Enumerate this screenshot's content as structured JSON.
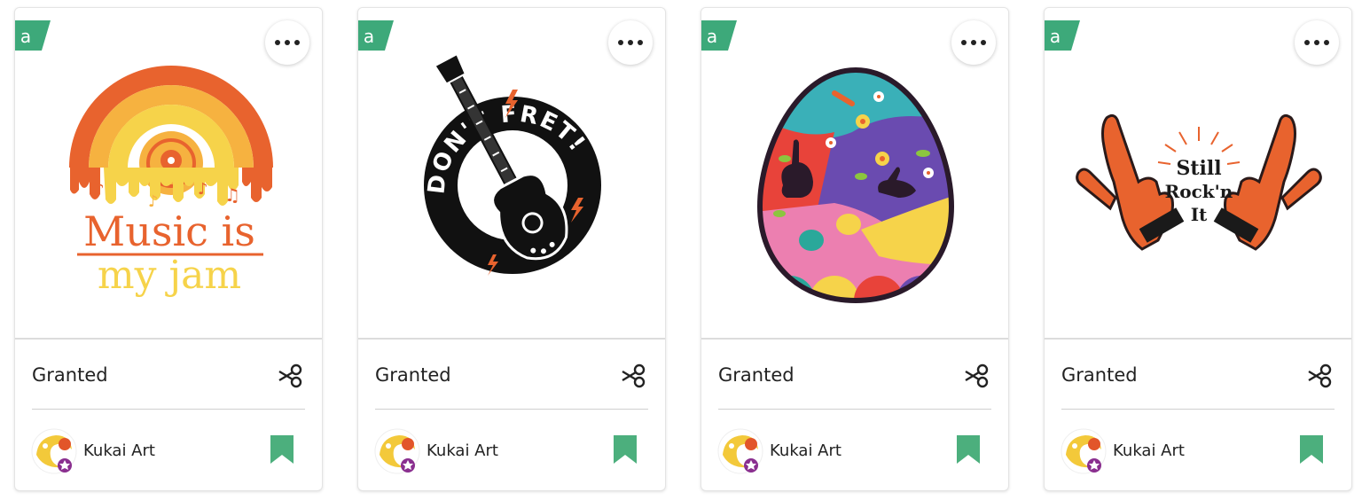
{
  "colors": {
    "badge_green": "#3da97a",
    "save_green": "#4caf7d",
    "avatar_yellow": "#f3c93a",
    "avatar_orange": "#e2552a",
    "avatar_purple": "#8a2f8f"
  },
  "cards": [
    {
      "art": "music-is-my-jam-rainbow-record",
      "art_text_line1": "Music is",
      "art_text_line2": "my jam",
      "license": "Granted",
      "designer": "Kukai Art",
      "badge_icon": "access-a-icon",
      "cut_icon": "scissors-icon",
      "save_icon": "bookmark-icon"
    },
    {
      "art": "dont-fret-guitar-circle",
      "art_text": "DON'T FRET!",
      "license": "Granted",
      "designer": "Kukai Art",
      "badge_icon": "access-a-icon",
      "cut_icon": "scissors-icon",
      "save_icon": "bookmark-icon"
    },
    {
      "art": "easter-egg-mosaic",
      "license": "Granted",
      "designer": "Kukai Art",
      "badge_icon": "access-a-icon",
      "cut_icon": "scissors-icon",
      "save_icon": "bookmark-icon"
    },
    {
      "art": "still-rockn-it-hands",
      "art_text_line1": "Still",
      "art_text_line2": "Rock'n",
      "art_text_line3": "It",
      "license": "Granted",
      "designer": "Kukai Art",
      "badge_icon": "access-a-icon",
      "cut_icon": "scissors-icon",
      "save_icon": "bookmark-icon"
    }
  ]
}
